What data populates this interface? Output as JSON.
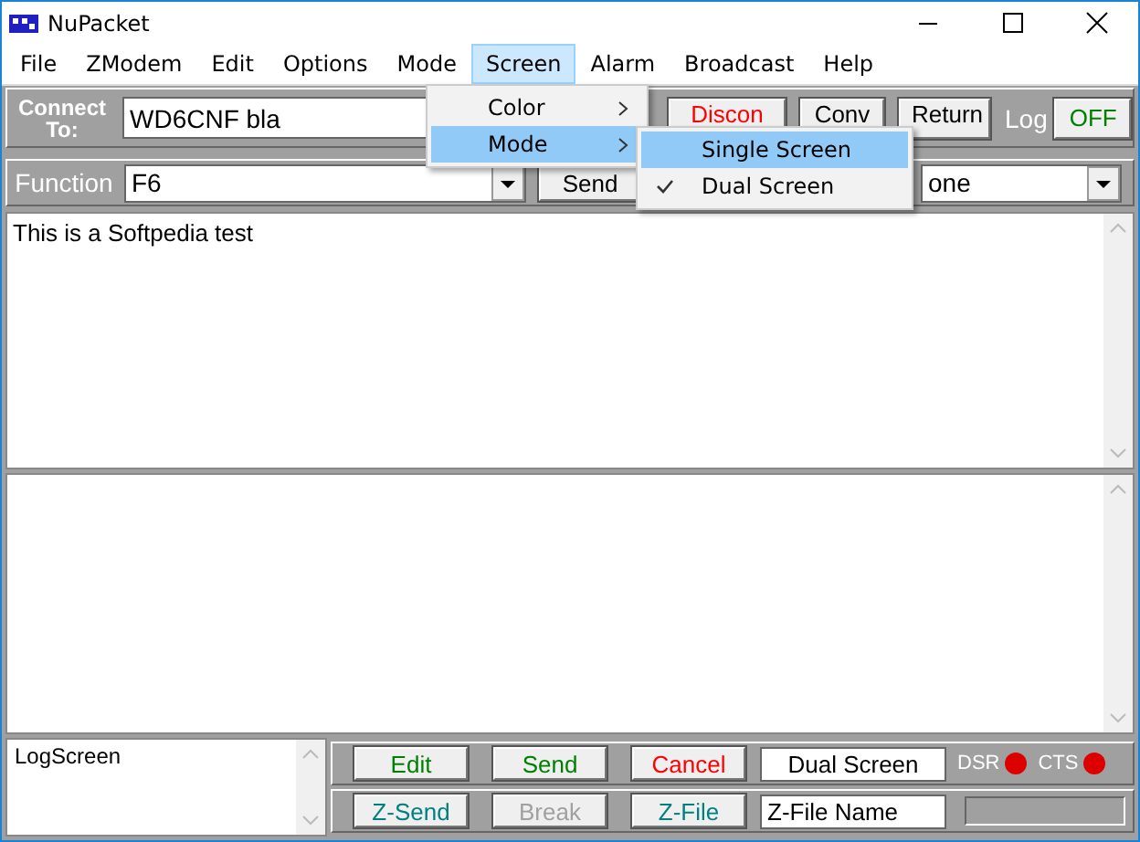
{
  "window": {
    "title": "NuPacket"
  },
  "menu_bar": [
    {
      "label": "File",
      "selected": false
    },
    {
      "label": "ZModem",
      "selected": false
    },
    {
      "label": "Edit",
      "selected": false
    },
    {
      "label": "Options",
      "selected": false
    },
    {
      "label": "Mode",
      "selected": false
    },
    {
      "label": "Screen",
      "selected": true
    },
    {
      "label": "Alarm",
      "selected": false
    },
    {
      "label": "Broadcast",
      "selected": false
    },
    {
      "label": "Help",
      "selected": false
    }
  ],
  "connect": {
    "label": "Connect To:",
    "value": "WD6CNF bla"
  },
  "connect_buttons": [
    {
      "label": "Discon",
      "color": "#ff0000"
    },
    {
      "label": "Conv",
      "color": "#000000"
    },
    {
      "label": "Return",
      "color": "#000000"
    }
  ],
  "log": {
    "label": "Log",
    "toggle": "OFF"
  },
  "function": {
    "label": "Function",
    "value": "F6",
    "send": "Send",
    "dropdown": "one"
  },
  "main_text": "This is a Softpedia test",
  "log_screen": "LogScreen",
  "bottom_rows": [
    [
      {
        "label": "Edit",
        "color": "#008000",
        "disabled": false
      },
      {
        "label": "Send",
        "color": "#008000",
        "disabled": false
      },
      {
        "label": "Cancel",
        "color": "#ff0000",
        "disabled": false
      }
    ],
    [
      {
        "label": "Z-Send",
        "color": "#008080",
        "disabled": false
      },
      {
        "label": "Break",
        "disabled": true
      },
      {
        "label": "Z-File",
        "color": "#008080",
        "disabled": false
      }
    ]
  ],
  "mode_field": "Dual Screen",
  "indicators": [
    {
      "label": "DSR",
      "color": "#dd0000"
    },
    {
      "label": "CTS",
      "color": "#dd0000"
    }
  ],
  "zfile_field": "Z-File Name",
  "screen_menu": [
    {
      "label": "Color",
      "selected": false
    },
    {
      "label": "Mode",
      "selected": true
    }
  ],
  "mode_submenu": [
    {
      "label": "Single Screen",
      "checked": false,
      "selected": true
    },
    {
      "label": "Dual Screen",
      "checked": true,
      "selected": false
    }
  ]
}
